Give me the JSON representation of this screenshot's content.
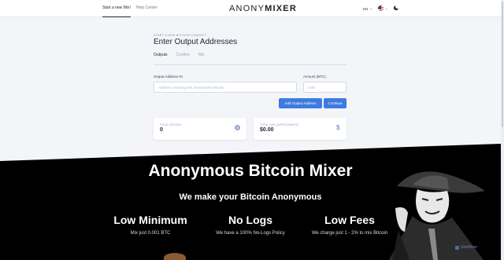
{
  "nav": {
    "start_mix": "Start a new Mix!",
    "help": "Help Center"
  },
  "logo": {
    "part1": "ANONY",
    "part2": "MIXER"
  },
  "lang": {
    "code": "EN"
  },
  "page": {
    "step": "START A NEW BITCOIN CONNECT",
    "title": "Enter Output Addresses",
    "tabs": [
      "Outputs",
      "Confirm",
      "Mix"
    ]
  },
  "form": {
    "address_label": "Output Address #1",
    "address_placeholder": "Address receiving the anonymized Bitcoin",
    "amount_label": "Amount (BTC)",
    "amount_placeholder": "0.00",
    "add_button": "Add Output Address",
    "continue_button": "Continue"
  },
  "cards": {
    "bitcoin_label": "TOTAL BITCOIN",
    "bitcoin_value": "0",
    "bitcoin_symbol": "₿",
    "usd_label": "TOTAL USD (APPROXIMATE)",
    "usd_value": "$0.00",
    "usd_symbol": "$"
  },
  "hero": {
    "title": "Anonymous Bitcoin Mixer",
    "subtitle": "We make your Bitcoin Anonymous",
    "features": [
      {
        "title": "Low Minimum",
        "sub": "Mix just 0.001 BTC"
      },
      {
        "title": "No Logs",
        "sub": "We have a 100% No-Logs Policy"
      },
      {
        "title": "Low Fees",
        "sub": "We charge just 1 - 2% to mix Bitcoin"
      }
    ]
  },
  "watermark": "SiteMiner",
  "colors": {
    "accent": "#3d7be0",
    "hero_bg": "#000000"
  },
  "icons": [
    "chevron-down-icon",
    "us-flag-icon",
    "moon-icon",
    "bitcoin-icon",
    "dollar-icon"
  ]
}
